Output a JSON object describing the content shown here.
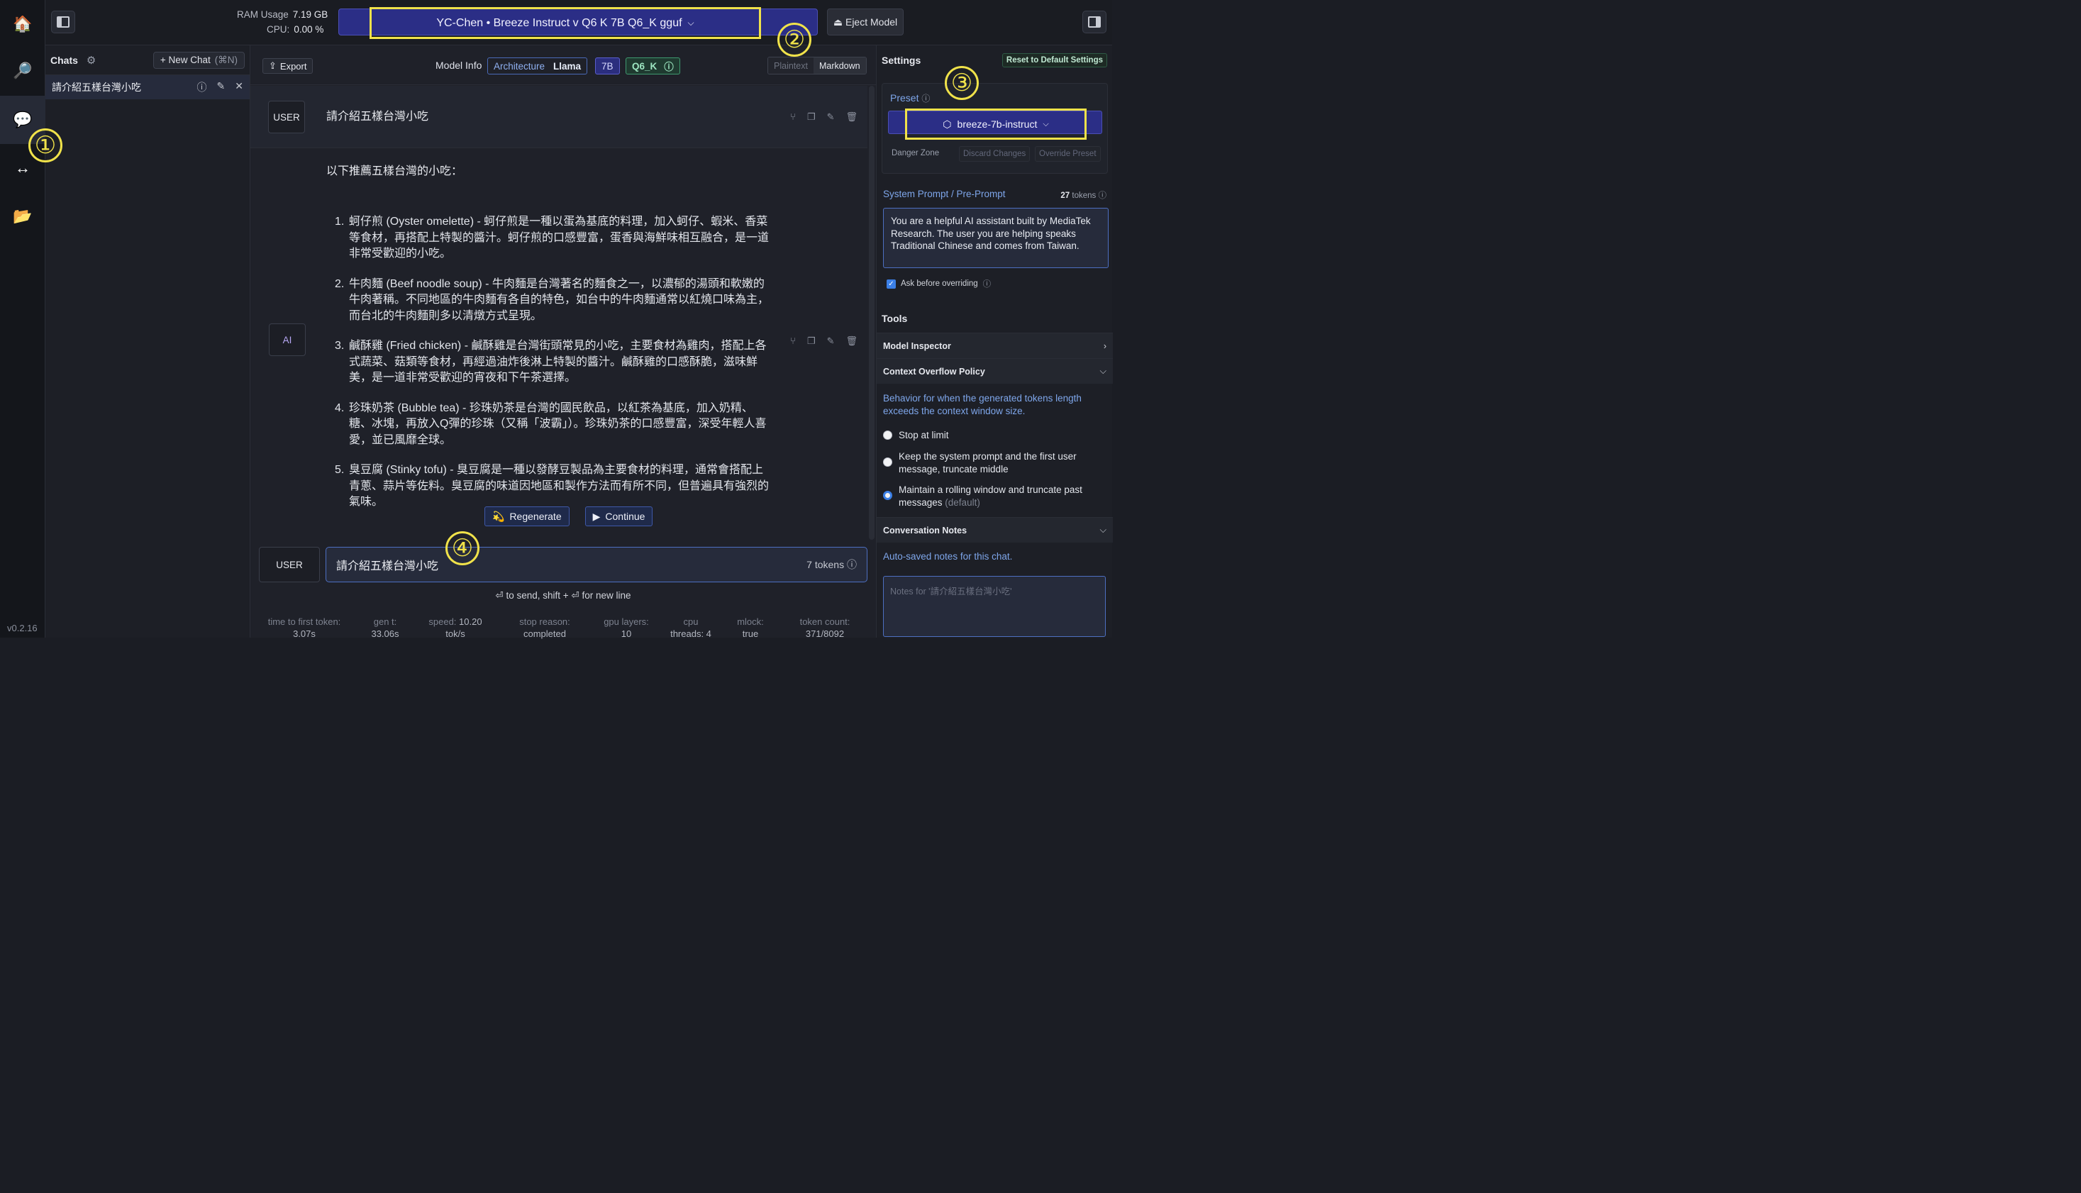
{
  "sidebar": {
    "items": [
      {
        "icon": "home-icon",
        "glyph": "🏠"
      },
      {
        "icon": "search-icon",
        "glyph": "🔎"
      },
      {
        "icon": "chat-icon",
        "glyph": "💬"
      },
      {
        "icon": "arrows-icon",
        "glyph": "↔"
      },
      {
        "icon": "folder-icon",
        "glyph": "📂"
      }
    ],
    "version": "v0.2.16"
  },
  "topbar": {
    "ram_label": "RAM Usage",
    "ram_value": "7.19 GB",
    "cpu_label": "CPU:",
    "cpu_value": "0.00 %",
    "model_name": "YC-Chen • Breeze Instruct v Q6 K 7B Q6_K gguf",
    "eject_label": "⏏ Eject Model"
  },
  "annotations": [
    "①",
    "②",
    "③",
    "④"
  ],
  "chats": {
    "title": "Chats",
    "new_chat_label": "+ New Chat",
    "new_chat_shortcut": "(⌘N)",
    "items": [
      {
        "label": "請介紹五樣台灣小吃"
      }
    ]
  },
  "main": {
    "export_label": "Export",
    "model_info_label": "Model Info",
    "architecture_label": "Architecture",
    "architecture_value": "Llama",
    "size_badge": "7B",
    "quant_badge": "Q6_K",
    "format_tabs": [
      "Plaintext",
      "Markdown"
    ],
    "user_role": "USER",
    "ai_role": "AI",
    "user_message": "請介紹五樣台灣小吃",
    "ai_intro": "以下推薦五樣台灣的小吃：",
    "ai_items": [
      {
        "n": "1.",
        "text": "蚵仔煎 (Oyster omelette) - 蚵仔煎是一種以蛋為基底的料理，加入蚵仔、蝦米、香菜等食材，再搭配上特製的醬汁。蚵仔煎的口感豐富，蛋香與海鮮味相互融合，是一道非常受歡迎的小吃。"
      },
      {
        "n": "2.",
        "text": "牛肉麵 (Beef noodle soup) - 牛肉麵是台灣著名的麵食之一，以濃郁的湯頭和軟嫩的牛肉著稱。不同地區的牛肉麵有各自的特色，如台中的牛肉麵通常以紅燒口味為主，而台北的牛肉麵則多以清燉方式呈現。"
      },
      {
        "n": "3.",
        "text": "鹹酥雞 (Fried chicken) - 鹹酥雞是台灣街頭常見的小吃，主要食材為雞肉，搭配上各式蔬菜、菇類等食材，再經過油炸後淋上特製的醬汁。鹹酥雞的口感酥脆，滋味鮮美，是一道非常受歡迎的宵夜和下午茶選擇。"
      },
      {
        "n": "4.",
        "text": "珍珠奶茶 (Bubble tea) - 珍珠奶茶是台灣的國民飲品，以紅茶為基底，加入奶精、糖、冰塊，再放入Q彈的珍珠（又稱「波霸」）。珍珠奶茶的口感豐富，深受年輕人喜愛，並已風靡全球。"
      },
      {
        "n": "5.",
        "text": "臭豆腐 (Stinky tofu) - 臭豆腐是一種以發酵豆製品為主要食材的料理，通常會搭配上青蔥、蒜片等佐料。臭豆腐的味道因地區和製作方法而有所不同，但普遍具有強烈的氣味。"
      }
    ],
    "regenerate_label": "Regenerate",
    "continue_label": "Continue",
    "input_role": "USER",
    "input_value": "請介紹五樣台灣小吃",
    "input_tokens": "7 tokens",
    "hint": "⏎ to send, shift + ⏎ for new line",
    "stats": [
      {
        "label": "time to first token:",
        "value": "3.07s"
      },
      {
        "label": "gen t:",
        "value": "33.06s"
      },
      {
        "label": "speed: ",
        "value2": "10.20",
        "value": "tok/s"
      },
      {
        "label": "stop reason:",
        "value": "completed"
      },
      {
        "label": "gpu layers:",
        "value": "10"
      },
      {
        "label": "cpu",
        "value": "threads: 4"
      },
      {
        "label": "mlock:",
        "value": "true"
      },
      {
        "label": "token count:",
        "value": "371/8092"
      }
    ]
  },
  "settings": {
    "title": "Settings",
    "reset_label": "Reset to Default Settings",
    "preset_label": "Preset",
    "preset_value": "breeze-7b-instruct",
    "danger_label": "Danger Zone",
    "discard_label": "Discard Changes",
    "override_label": "Override Preset",
    "system_prompt_label": "System Prompt / Pre-Prompt",
    "system_prompt_tokens_num": "27",
    "system_prompt_tokens_unit": "tokens",
    "system_prompt": "You are a helpful AI assistant built by MediaTek Research. The user you are helping speaks Traditional Chinese and comes from Taiwan.",
    "ask_before_overriding": "Ask before overriding",
    "tools_label": "Tools",
    "model_inspector": "Model Inspector",
    "context_overflow": "Context Overflow Policy",
    "policy_desc": "Behavior for when the generated tokens length exceeds the context window size.",
    "policy_options": [
      {
        "label": "Stop at limit"
      },
      {
        "label": "Keep the system prompt and the first user message, truncate middle"
      },
      {
        "label": "Maintain a rolling window and truncate past messages",
        "suffix": "(default)"
      }
    ],
    "conversation_notes": "Conversation Notes",
    "notes_desc": "Auto-saved notes for this chat.",
    "notes_placeholder": "Notes for '請介紹五樣台灣小吃'"
  }
}
